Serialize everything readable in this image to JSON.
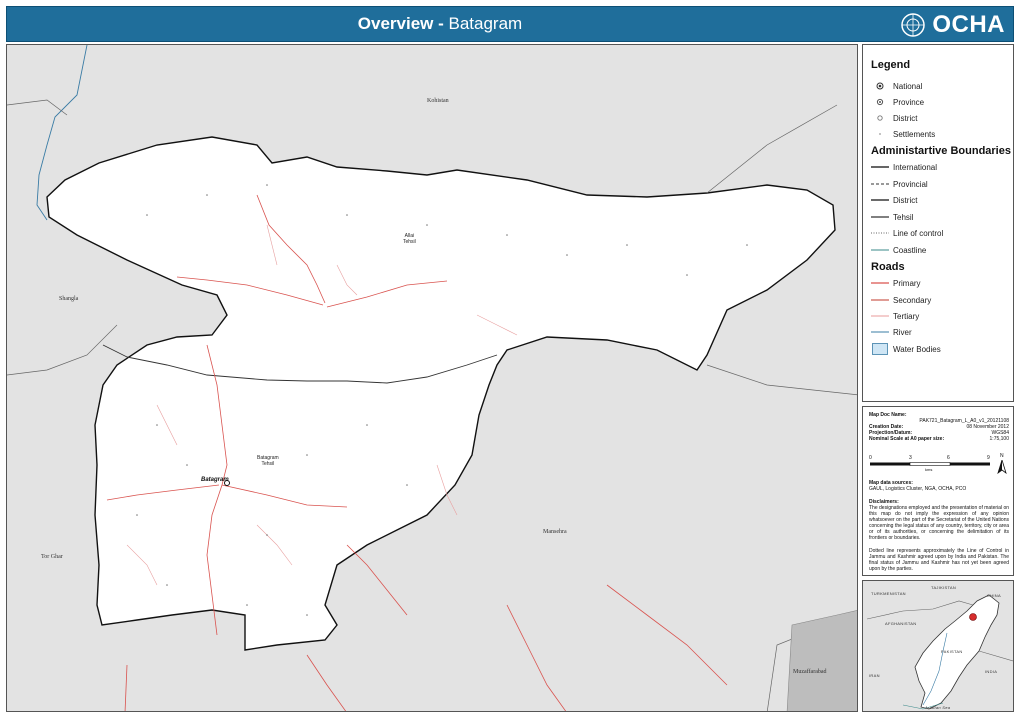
{
  "header": {
    "title_bold": "Overview - ",
    "title_rest": "Batagram",
    "logo_text": "OCHA"
  },
  "map": {
    "neighbours": {
      "kohistan": "Kohistan",
      "shangla": "Shangla",
      "mansehra": "Mansehra",
      "tor_ghar": "Tor Ghar",
      "muzaffarabad": "Muzaffarabad"
    },
    "tehsils": {
      "allai_1": "Allai",
      "allai_2": "Tehsil",
      "batagram_1": "Batagram",
      "batagram_2": "Tehsil"
    },
    "district_capital": "Batagram"
  },
  "legend": {
    "title": "Legend",
    "capitals": [
      {
        "label": "National",
        "icon": "national-capital-icon"
      },
      {
        "label": "Province",
        "icon": "province-capital-icon"
      },
      {
        "label": "District",
        "icon": "district-capital-icon"
      },
      {
        "label": "Settlements",
        "icon": "settlement-icon"
      }
    ],
    "boundaries_title": "Administartive Boundaries",
    "boundaries": [
      {
        "label": "International",
        "style": "solid",
        "color": "#333333"
      },
      {
        "label": "Provincial",
        "style": "dashed",
        "color": "#333333"
      },
      {
        "label": "District",
        "style": "solid",
        "color": "#555555"
      },
      {
        "label": "Tehsil",
        "style": "solid",
        "color": "#000000"
      },
      {
        "label": "Line of control",
        "style": "dotted",
        "color": "#666666"
      },
      {
        "label": "Coastline",
        "style": "solid",
        "color": "#3a8a8a"
      }
    ],
    "roads_title": "Roads",
    "roads": [
      {
        "label": "Primary",
        "color": "#d9534f"
      },
      {
        "label": "Secondary",
        "color": "#c0392b"
      },
      {
        "label": "Tertiary",
        "color": "#e07a7a"
      },
      {
        "label": "River",
        "color": "#3a7ca5"
      }
    ],
    "water": {
      "label": "Water Bodies",
      "color": "#cfe6f5"
    }
  },
  "info": {
    "doc_name_label": "Map Doc Name:",
    "doc_name": "PAK721_Batagram_L_A0_v1_20121108",
    "creation_label": "Creation Date:",
    "creation": "08 November 2012",
    "projection_label": "Projection/Datum:",
    "projection": "WGS84",
    "scale_label": "Nominal Scale at A0 paper size:",
    "scale": "1:75,100",
    "scale_ticks": [
      "0",
      "3",
      "6",
      "9"
    ],
    "scale_unit": "kms",
    "north": "N",
    "sources_label": "Map data sources:",
    "sources": "GAUL, Logistics Cluster, NGA, OCHA, PCO",
    "disclaimer_label": "Disclaimers:",
    "disclaimer": "The designations employed and the presentation of material on this map do not imply the expression of any opinion whatsoever on the part of the Secretariat of the United Nations concerning the legal status of any country, territory, city or area or of its authorities, or concerning the delimitation of its frontiers or boundaries.",
    "loc_note": "Dotted line represents approximately the Line of Control in Jammu and Kashmir agreed upon by India and Pakistan. The final status of Jammu and Kashmir has not yet been agreed upon by the parties."
  },
  "inset": {
    "turkmenistan": "TURKMENISTAN",
    "tajikistan": "TAJIKISTAN",
    "china": "CHINA",
    "afghanistan": "AFGHANISTAN",
    "pakistan": "PAKISTAN",
    "india": "INDIA",
    "iran": "IRAN",
    "arabian_sea": "Arabian Sea"
  }
}
